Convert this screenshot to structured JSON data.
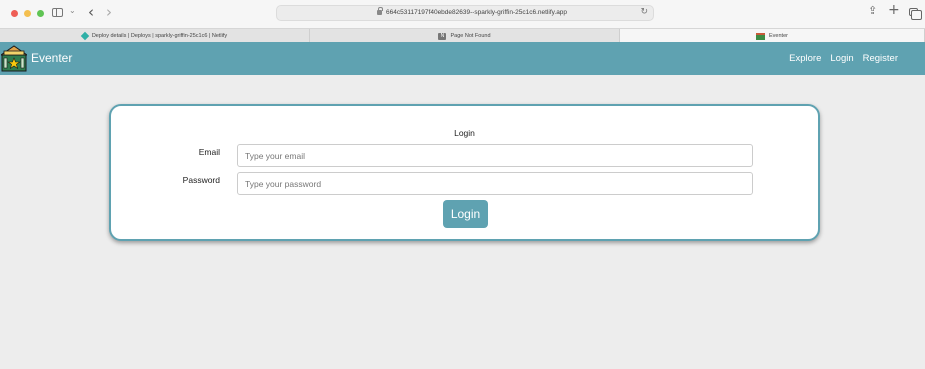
{
  "browser": {
    "url": "664c53117197f40ebde82639--sparkly-griffin-25c1c6.netlify.app",
    "back_glyph": "‹",
    "forward_glyph": "›",
    "reload_glyph": "↻",
    "share_glyph": "⇪",
    "new_tab_glyph": "+",
    "small_chevron_glyph": "⌄",
    "tabs": [
      {
        "title": "Deploy details | Deploys | sparkly-griffin-25c1c6 | Netlify",
        "icon": "netlify-icon"
      },
      {
        "title": "Page Not Found",
        "icon": "n-icon",
        "icon_letter": "N"
      },
      {
        "title": "Eventer",
        "icon": "eventer-favicon",
        "active": true
      }
    ]
  },
  "navbar": {
    "brand": "Eventer",
    "links": [
      "Explore",
      "Login",
      "Register"
    ],
    "background": "#5fa2b1"
  },
  "login": {
    "title": "Login",
    "email_label": "Email",
    "email_placeholder": "Type your email",
    "password_label": "Password",
    "password_placeholder": "Type your password",
    "button_label": "Login",
    "accent": "#5fa2b1"
  }
}
